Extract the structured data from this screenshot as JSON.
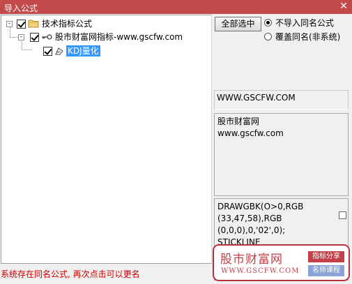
{
  "window": {
    "title": "导入公式",
    "close_glyph": "✕"
  },
  "tree": {
    "root": {
      "label": "技术指标公式",
      "expander": "-",
      "icon": "folder-icon"
    },
    "child": {
      "label": "股市财富网指标-www.gscfw.com",
      "expander": "-",
      "icon": "key-icon"
    },
    "leaf": {
      "label": "KDJ量化",
      "icon": "formula-icon",
      "selected": true
    }
  },
  "controls": {
    "select_all": "全部选中",
    "options": [
      {
        "label": "不导入同名公式",
        "checked": true
      },
      {
        "label": "覆盖同名(非系统)",
        "checked": false
      }
    ]
  },
  "info": {
    "url": "WWW.GSCFW.COM",
    "description": [
      "股市财富网",
      "www.gscfw.com"
    ],
    "code": [
      "DRAWGBK(O>0,RGB",
      "(33,47,58),RGB",
      "(0,0,0),0,'02',0);",
      "STICKLINE"
    ]
  },
  "status_text": "系统存在同名公式, 再次点击可以更名",
  "watermark": {
    "brand": "股市财富网",
    "url": "WWW.GSCFW.COM",
    "tag1": "指标分享",
    "tag2": "名师课程"
  },
  "colors": {
    "titlebar": "#c24a4a",
    "selection": "#3399ff",
    "status_text": "#c80000"
  }
}
